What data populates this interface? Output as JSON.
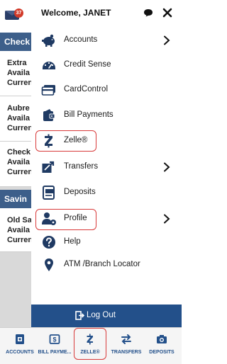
{
  "background": {
    "mail_badge": "37",
    "sections": [
      {
        "title": "Check"
      },
      {
        "title": "Savin"
      }
    ],
    "accounts": [
      {
        "lines": [
          "Extra",
          "Availa",
          "Curren"
        ]
      },
      {
        "lines": [
          "Aubre",
          "Availa",
          "Curren"
        ]
      },
      {
        "lines": [
          "Check",
          "Availa",
          "Curren"
        ]
      },
      {
        "lines": [
          "Old Sa",
          "Availa",
          "Curren"
        ]
      }
    ]
  },
  "drawer": {
    "welcome": "Welcome, JANET",
    "icons": {
      "chat": "chat-bubble-icon",
      "close": "close-icon"
    },
    "menu": [
      {
        "label": "Accounts",
        "icon": "piggy-bank-icon",
        "has_chevron": true
      },
      {
        "label": "Credit Sense",
        "icon": "gauge-icon",
        "has_chevron": false
      },
      {
        "label": "CardControl",
        "icon": "credit-card-icon",
        "has_chevron": false
      },
      {
        "label": "Bill Payments",
        "icon": "wallet-icon",
        "has_chevron": false
      },
      {
        "label": "Zelle®",
        "icon": "zelle-icon",
        "has_chevron": false,
        "highlighted": true
      },
      {
        "label": "Transfers",
        "icon": "transfer-icon",
        "has_chevron": true
      },
      {
        "label": "Deposits",
        "icon": "check-deposit-icon",
        "has_chevron": false
      },
      {
        "label": "Profile",
        "icon": "user-gear-icon",
        "has_chevron": true,
        "highlighted": true
      },
      {
        "label": "Help",
        "icon": "help-icon",
        "has_chevron": false
      },
      {
        "label": "ATM /Branch Locator",
        "icon": "map-pin-icon",
        "has_chevron": false
      }
    ],
    "logout_label": "Log Out"
  },
  "bottom_nav": [
    {
      "label": "ACCOUNTS",
      "icon": "accounts-icon"
    },
    {
      "label": "BILL PAYME...",
      "icon": "bill-pay-icon"
    },
    {
      "label": "ZELLE®",
      "icon": "zelle-icon",
      "highlighted": true
    },
    {
      "label": "TRANSFERS",
      "icon": "transfer-arrows-icon"
    },
    {
      "label": "DEPOSITS",
      "icon": "camera-icon"
    }
  ],
  "colors": {
    "primary": "#23508a",
    "icon": "#1f3a63",
    "highlight": "#d83a3a",
    "section_header": "#3d5f8a"
  }
}
